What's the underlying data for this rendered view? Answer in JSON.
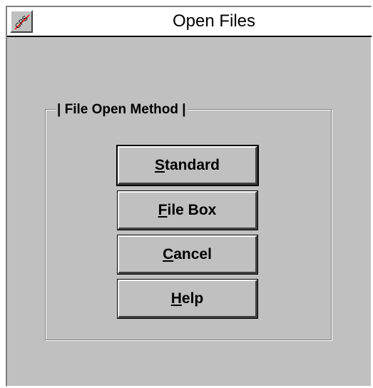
{
  "window": {
    "title": "Open Files",
    "system_menu_icon_label": "CPS"
  },
  "group": {
    "label": "| File Open Method |"
  },
  "buttons": [
    {
      "mnemonic": "S",
      "rest": "tandard",
      "is_default": true
    },
    {
      "mnemonic": "F",
      "rest": "ile Box",
      "is_default": false
    },
    {
      "mnemonic": "C",
      "rest": "ancel",
      "is_default": false
    },
    {
      "mnemonic": "H",
      "rest": "elp",
      "is_default": false
    }
  ],
  "colors": {
    "face": "#c0c0c0",
    "title_bg": "#ffffff",
    "icon_slash": "#ff0000"
  }
}
